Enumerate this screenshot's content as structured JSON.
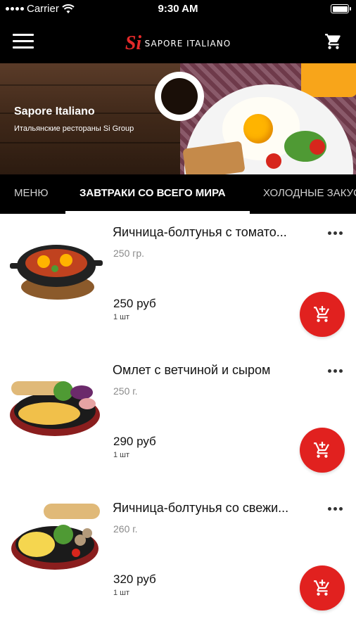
{
  "status_bar": {
    "carrier": "Carrier",
    "time": "9:30 AM"
  },
  "header": {
    "logo_mark": "Si",
    "logo_text": "SAPORE ITALIANO"
  },
  "hero": {
    "title": "Sapore Italiano",
    "subtitle": "Итальянские рестораны Si Group"
  },
  "tabs": [
    {
      "label": "МЕНЮ",
      "active": false
    },
    {
      "label": "ЗАВТРАКИ СО ВСЕГО МИРА",
      "active": true
    },
    {
      "label": "ХОЛОДНЫЕ ЗАКУСКИ",
      "active": false
    }
  ],
  "items": [
    {
      "name": "Яичница-болтунья с томато...",
      "weight": "250 гр.",
      "price": "250 руб",
      "qty": "1 шт"
    },
    {
      "name": "Омлет с ветчиной и сыром",
      "weight": "250 г.",
      "price": "290 руб",
      "qty": "1 шт"
    },
    {
      "name": "Яичница-болтунья со свежи...",
      "weight": "260 г.",
      "price": "320 руб",
      "qty": "1 шт"
    }
  ],
  "colors": {
    "accent": "#e1211f",
    "header_bg": "#000000",
    "logo_red": "#e52a2a"
  }
}
